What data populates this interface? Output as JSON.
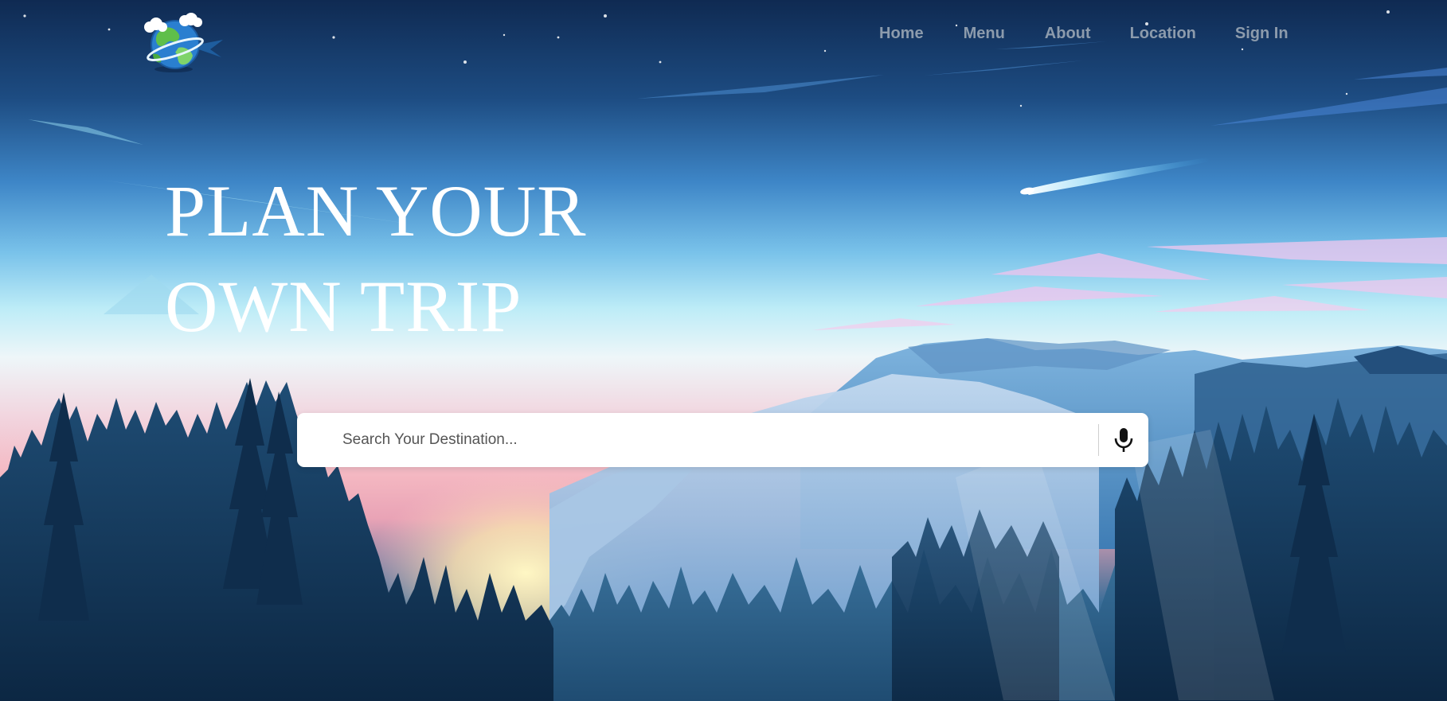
{
  "nav": {
    "items": [
      {
        "label": "Home"
      },
      {
        "label": "Menu"
      },
      {
        "label": "About"
      },
      {
        "label": "Location"
      },
      {
        "label": "Sign In"
      }
    ]
  },
  "hero": {
    "line1": "PLAN YOUR",
    "line2": "OWN TRIP"
  },
  "search": {
    "placeholder": "Search Your Destination...",
    "value": ""
  },
  "icons": {
    "logo": "globe-logo-icon",
    "mic": "microphone-icon"
  },
  "colors": {
    "nav_text": "#8c9bac",
    "headline": "#ffffff",
    "search_bg": "#ffffff"
  }
}
